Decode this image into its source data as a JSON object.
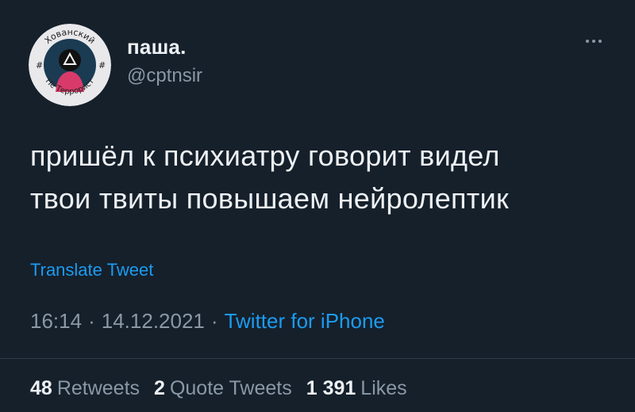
{
  "user": {
    "display_name": "паша.",
    "handle": "@cptnsir",
    "avatar_text_top": "Хованский",
    "avatar_text_bottom": "Не Террорист",
    "avatar_hashtag_left": "#",
    "avatar_hashtag_right": "#"
  },
  "tweet": {
    "lines": [
      "пришёл к психиатру говорит видел",
      "твои твиты повышаем нейролептик"
    ],
    "translate_label": "Translate Tweet",
    "time": "16:14",
    "date": "14.12.2021",
    "separator": "·",
    "source": "Twitter for iPhone"
  },
  "stats": {
    "retweets_count": "48",
    "retweets_label": "Retweets",
    "quote_count": "2",
    "quote_label": "Quote Tweets",
    "likes_count": "1 391",
    "likes_label": "Likes"
  },
  "icons": {
    "more": "more-horizontal-icon"
  },
  "colors": {
    "background": "#15202b",
    "text": "#eef1f4",
    "secondary": "#8b98a5",
    "link": "#1d9bf0"
  }
}
